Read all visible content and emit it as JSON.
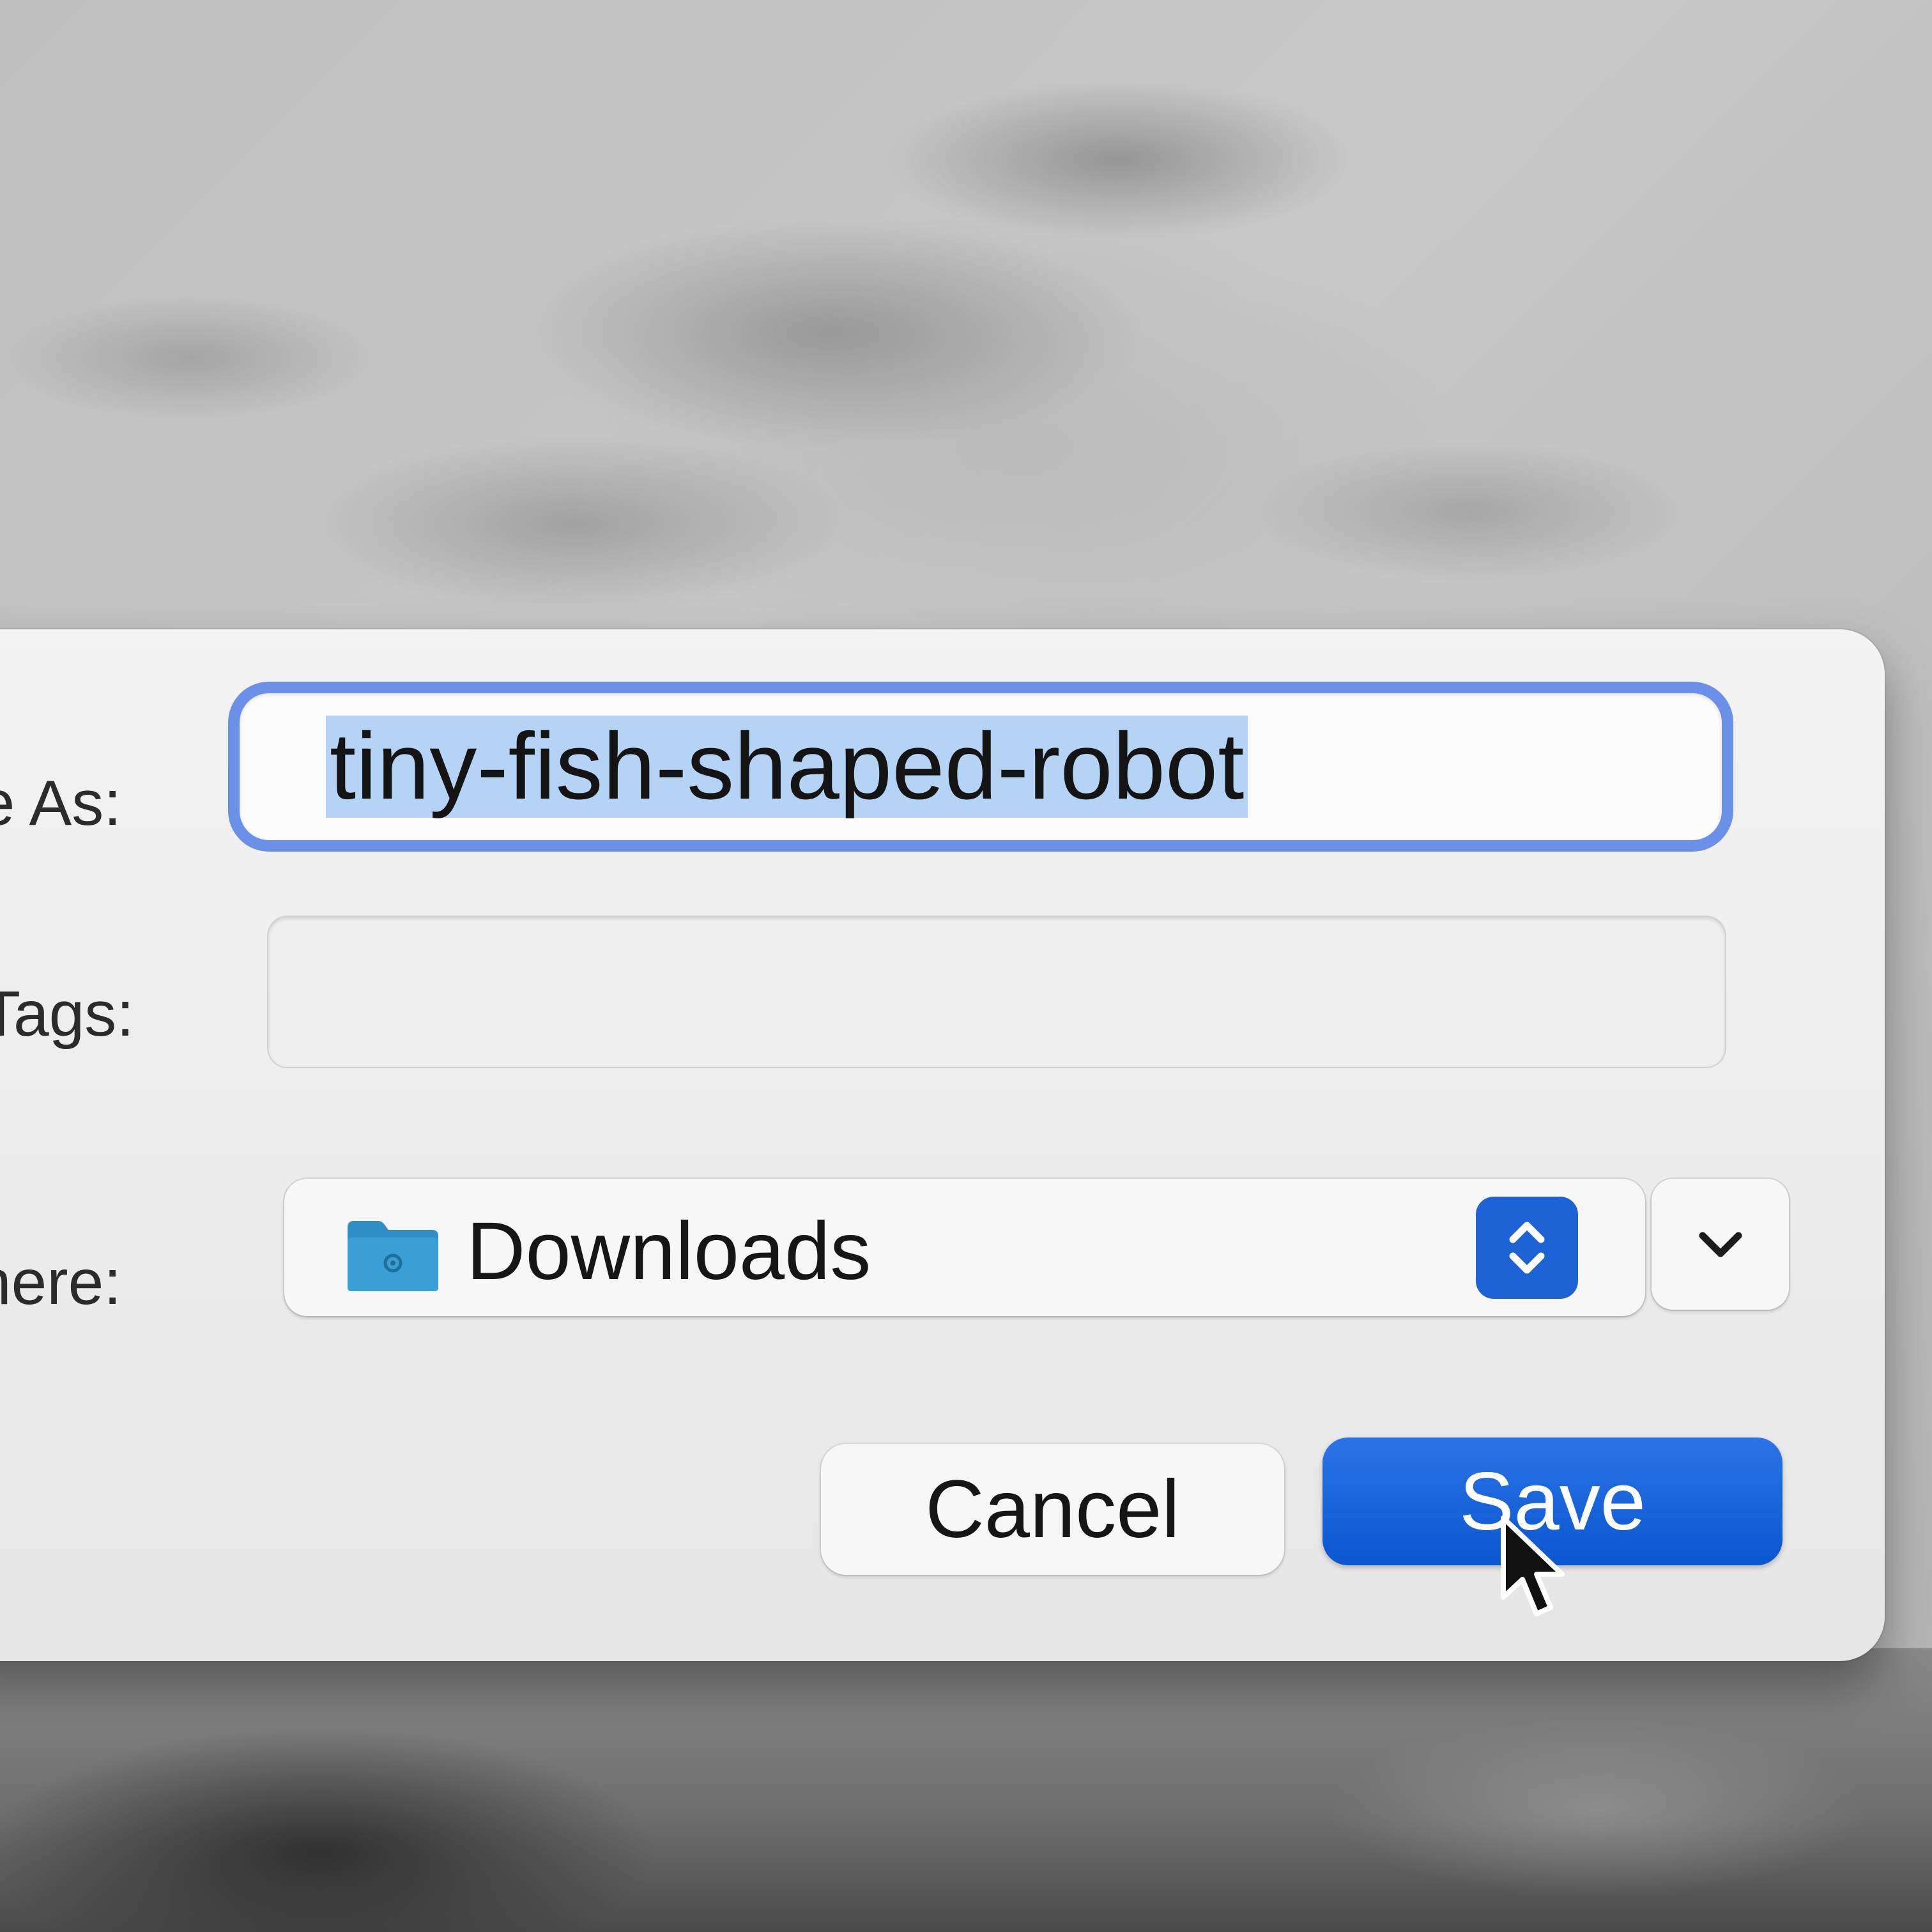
{
  "save_dialog": {
    "save_as_label": "ve As:",
    "filename_value": "tiny-fish-shaped-robot",
    "tags_label": "Tags:",
    "tags_value": "",
    "where_label": "Where:",
    "where_value": "Downloads",
    "where_icon": "folder-icon",
    "stepper_icon": "up-down-chevron-icon",
    "expand_icon": "chevron-down-icon",
    "cancel_label": "Cancel",
    "save_label": "Save"
  },
  "colors": {
    "accent": "#0b57d0",
    "focus_ring": "#6a90e8",
    "text_selection": "#b5d3f4",
    "folder": "#3a9fd4"
  },
  "cursor_icon": "arrow-pointer-icon"
}
